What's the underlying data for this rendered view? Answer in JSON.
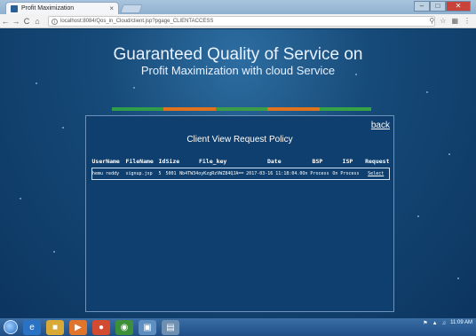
{
  "browser": {
    "tab_title": "Profit Maximization",
    "tab_close": "×",
    "url": "localhost:8084/Qos_in_Cloud/client.jsp?pgage_CLIENTACCESS",
    "nav": {
      "back": "←",
      "forward": "→",
      "reload": "C",
      "home": "⌂"
    },
    "info": "i",
    "right_icons": [
      "search",
      "star",
      "bookmark",
      "menu"
    ],
    "window_controls": {
      "minimize": "–",
      "maximize": "□",
      "close": "✕"
    }
  },
  "header": {
    "title": "Guaranteed Quality of Service on",
    "subtitle": "Profit Maximization with cloud Service"
  },
  "colorbar": [
    "#2f9d4a",
    "#e2731e",
    "#3c9c47",
    "#e2731e",
    "#35a245"
  ],
  "panel": {
    "back_link": "back",
    "title": "Client View Request Policy",
    "columns": [
      "UserName",
      "FileName",
      "Id",
      "Size",
      "File_key",
      "Date",
      "BSP",
      "ISP",
      "Request"
    ],
    "rows": [
      {
        "username": "hemu reddy",
        "filename": "signup.jsp",
        "id": "5",
        "size": "5001",
        "file_key": "Nb4TW34oyKzgRzVWZ84QJA==",
        "date": "2017-03-16 11:18:04.0",
        "bsp": "On Process",
        "isp": "On Process",
        "request": "Select"
      }
    ]
  },
  "taskbar": {
    "apps": [
      "ie-icon",
      "folder-icon",
      "media-icon",
      "browser-icon",
      "chrome-icon",
      "app-icon",
      "notepad-icon"
    ],
    "tray_time": "11:09 AM"
  }
}
